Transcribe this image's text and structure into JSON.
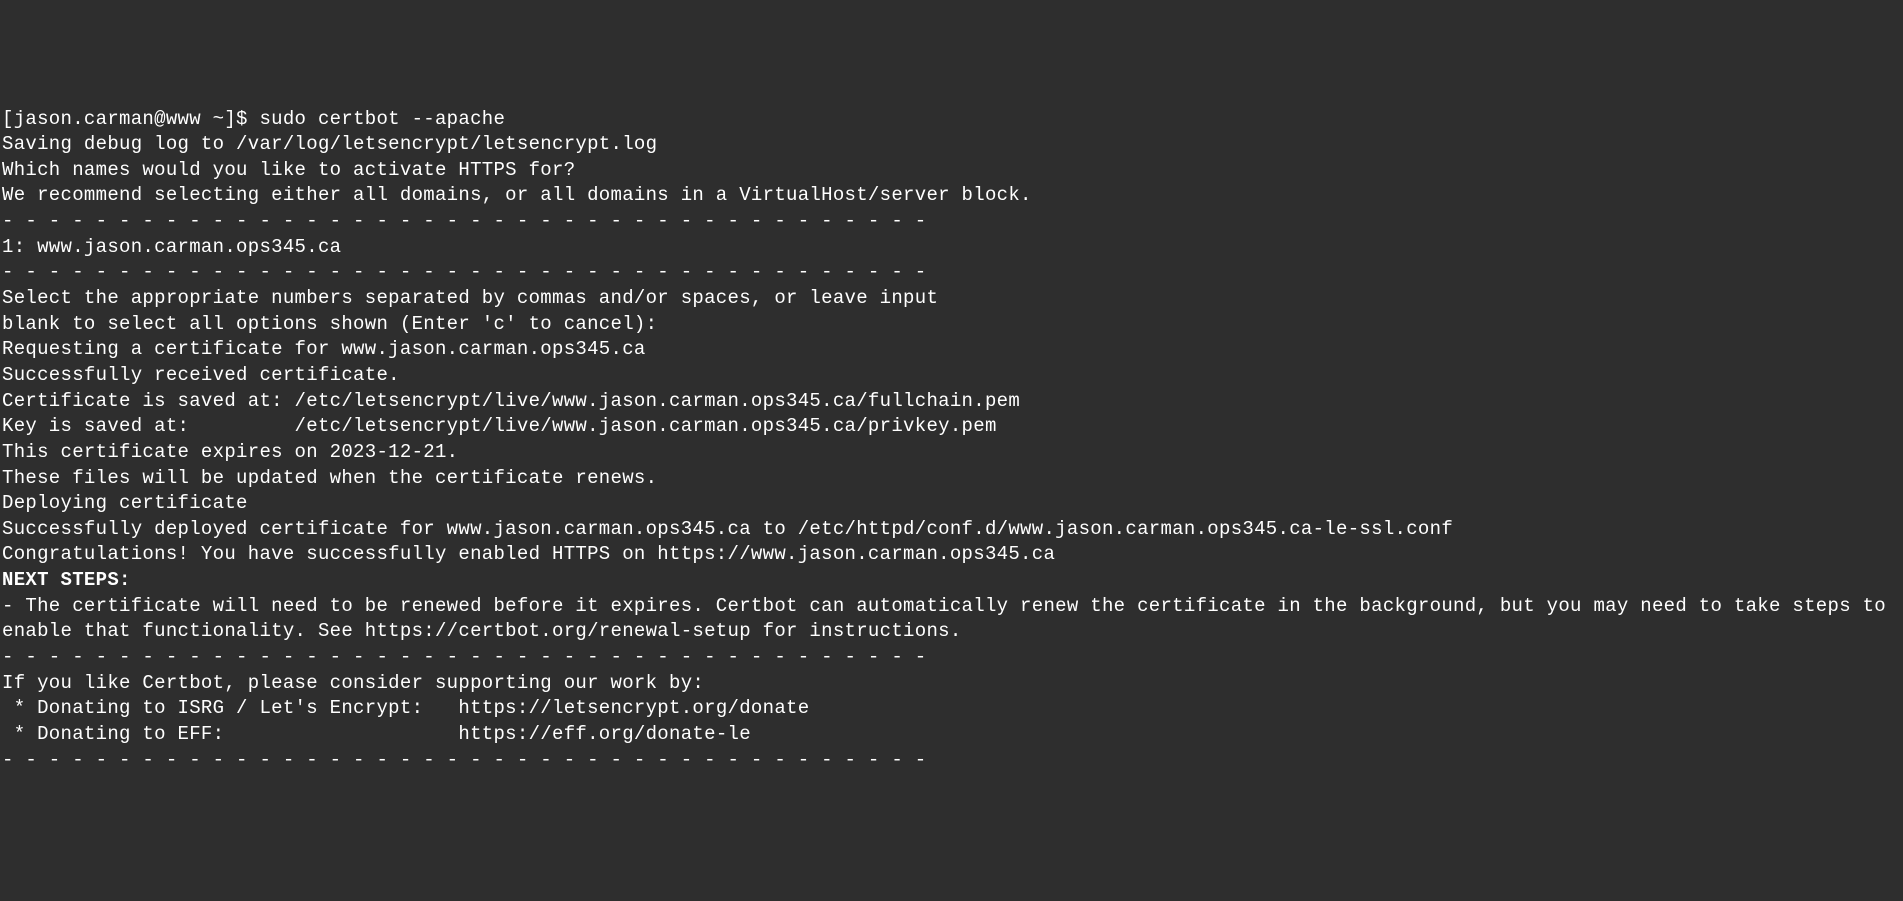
{
  "terminal": {
    "prompt": "[jason.carman@www ~]$ ",
    "command": "sudo certbot --apache",
    "lines": [
      "Saving debug log to /var/log/letsencrypt/letsencrypt.log",
      "",
      "Which names would you like to activate HTTPS for?",
      "We recommend selecting either all domains, or all domains in a VirtualHost/server block.",
      "- - - - - - - - - - - - - - - - - - - - - - - - - - - - - - - - - - - - - - - -",
      "1: www.jason.carman.ops345.ca",
      "- - - - - - - - - - - - - - - - - - - - - - - - - - - - - - - - - - - - - - - -",
      "Select the appropriate numbers separated by commas and/or spaces, or leave input",
      "blank to select all options shown (Enter 'c' to cancel): ",
      "Requesting a certificate for www.jason.carman.ops345.ca",
      "",
      "Successfully received certificate.",
      "Certificate is saved at: /etc/letsencrypt/live/www.jason.carman.ops345.ca/fullchain.pem",
      "Key is saved at:         /etc/letsencrypt/live/www.jason.carman.ops345.ca/privkey.pem",
      "This certificate expires on 2023-12-21.",
      "These files will be updated when the certificate renews.",
      "",
      "Deploying certificate",
      "Successfully deployed certificate for www.jason.carman.ops345.ca to /etc/httpd/conf.d/www.jason.carman.ops345.ca-le-ssl.conf",
      "Congratulations! You have successfully enabled HTTPS on https://www.jason.carman.ops345.ca",
      ""
    ],
    "next_steps_header": "NEXT STEPS:",
    "next_steps_lines": [
      "- The certificate will need to be renewed before it expires. Certbot can automatically renew the certificate in the background, but you may need to take steps to enable that functionality. See https://certbot.org/renewal-setup for instructions.",
      "",
      "- - - - - - - - - - - - - - - - - - - - - - - - - - - - - - - - - - - - - - - -",
      "If you like Certbot, please consider supporting our work by:",
      " * Donating to ISRG / Let's Encrypt:   https://letsencrypt.org/donate",
      " * Donating to EFF:                    https://eff.org/donate-le",
      "- - - - - - - - - - - - - - - - - - - - - - - - - - - - - - - - - - - - - - - -"
    ]
  }
}
